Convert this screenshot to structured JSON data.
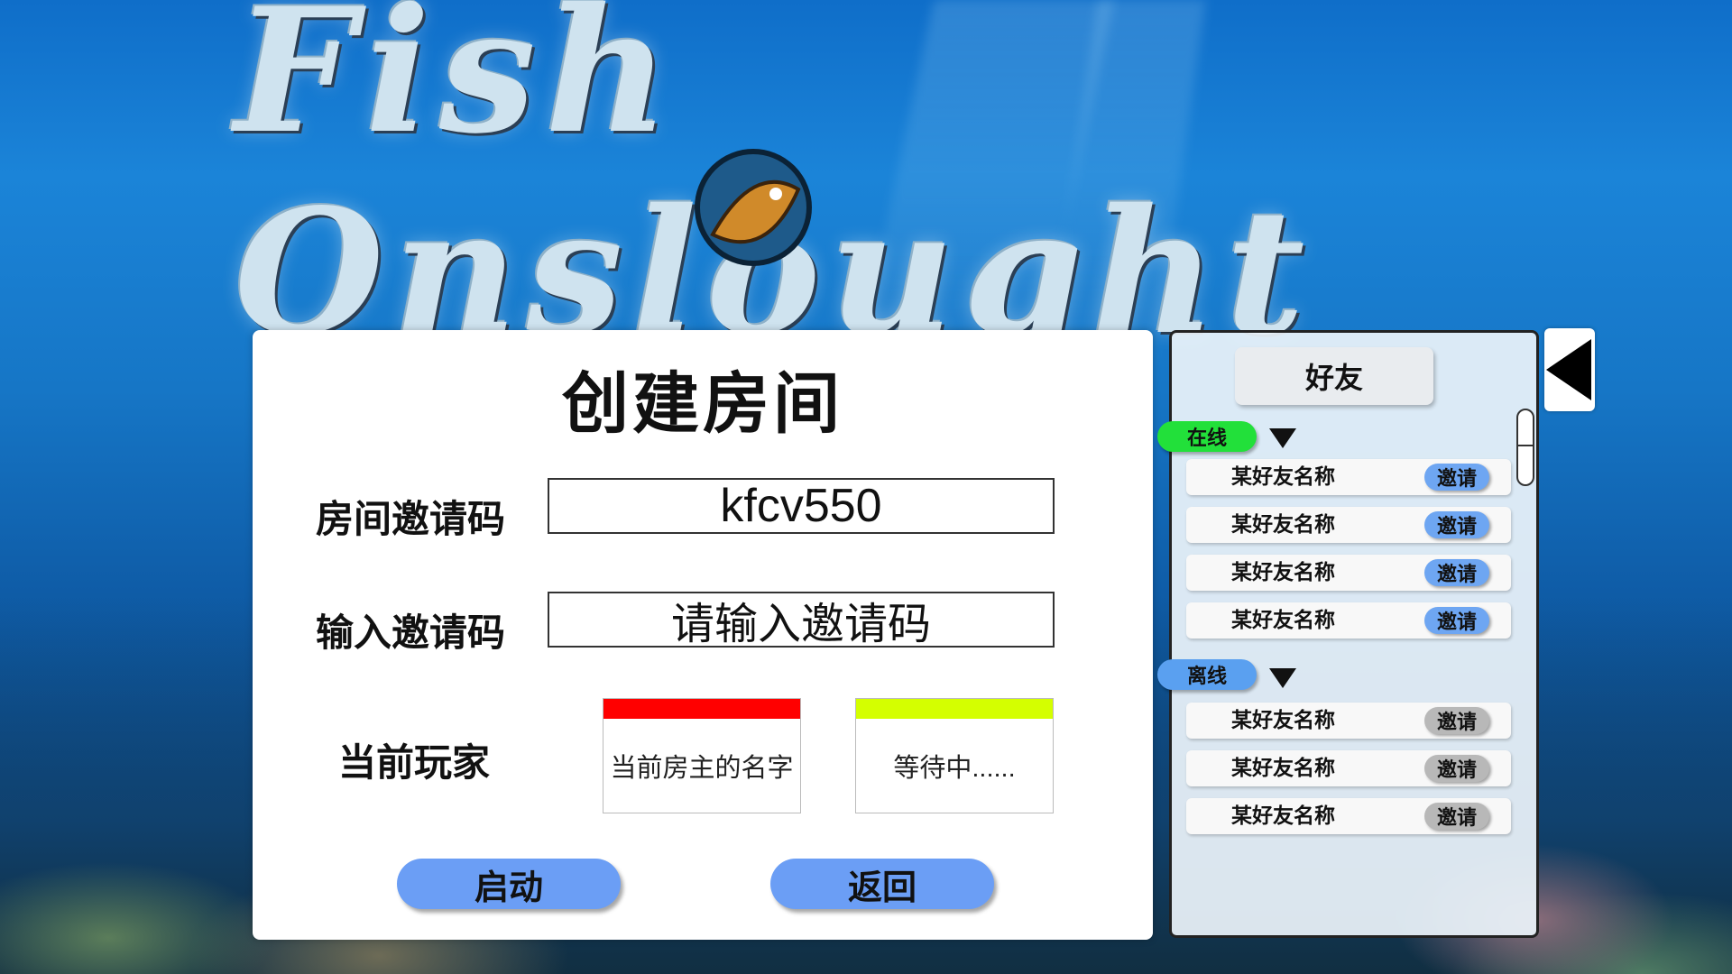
{
  "title": "Fish Onslought",
  "create_room": {
    "heading": "创建房间",
    "room_code_label": "房间邀请码",
    "room_code_value": "kfcv550",
    "input_code_label": "输入邀请码",
    "input_code_placeholder": "请输入邀请码",
    "current_players_label": "当前玩家",
    "players": [
      {
        "name": "当前房主的名字",
        "color": "#ff0000"
      },
      {
        "name": "等待中......",
        "color": "#d4ff00"
      }
    ],
    "start_button": "启动",
    "back_button": "返回"
  },
  "friends": {
    "header": "好友",
    "online_label": "在线",
    "offline_label": "离线",
    "online_color": "#22e03a",
    "offline_color": "#5aa0f0",
    "invite_online_color": "#6ea6f2",
    "invite_offline_color": "#b8b8b8",
    "online": [
      {
        "name": "某好友名称",
        "invite": "邀请"
      },
      {
        "name": "某好友名称",
        "invite": "邀请"
      },
      {
        "name": "某好友名称",
        "invite": "邀请"
      },
      {
        "name": "某好友名称",
        "invite": "邀请"
      }
    ],
    "offline": [
      {
        "name": "某好友名称",
        "invite": "邀请"
      },
      {
        "name": "某好友名称",
        "invite": "邀请"
      },
      {
        "name": "某好友名称",
        "invite": "邀请"
      }
    ]
  },
  "icons": {
    "collapse": "triangle-left-icon",
    "expand_online": "triangle-down-icon",
    "expand_offline": "triangle-down-icon"
  }
}
